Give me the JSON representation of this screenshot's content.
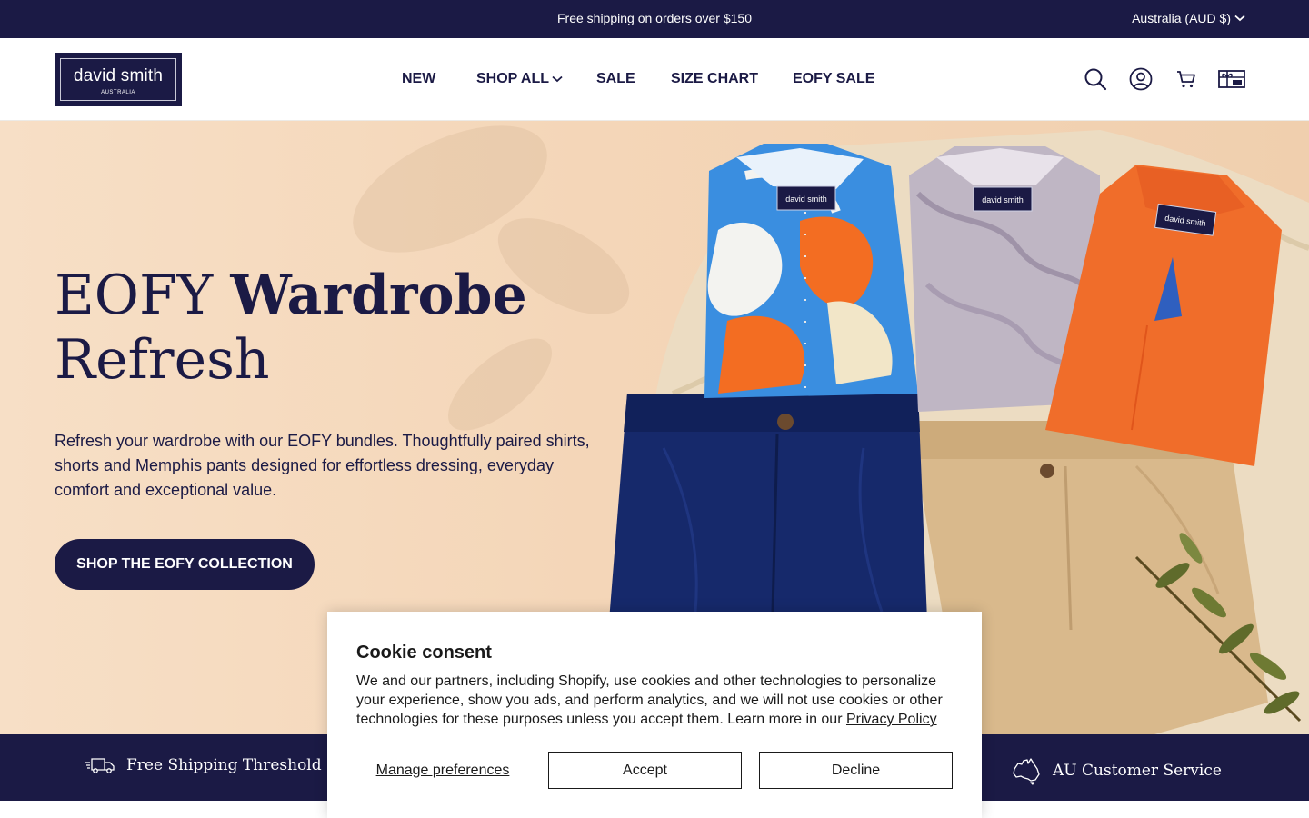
{
  "announcement": {
    "message": "Free shipping on orders over $150",
    "country": "Australia (AUD $)"
  },
  "logo": {
    "name": "david smith",
    "sub": "AUSTRALIA"
  },
  "nav": {
    "new": "NEW",
    "shop_all": "SHOP ALL",
    "sale": "SALE",
    "size_chart": "SIZE CHART",
    "eofy_sale": "EOFY SALE"
  },
  "header_icons": [
    "search-icon",
    "account-icon",
    "cart-icon",
    "gift-card-icon"
  ],
  "hero": {
    "title_part1": "EOFY ",
    "title_part2": "Wardrobe",
    "title_part3": "Refresh",
    "description": "Refresh your wardrobe with our EOFY bundles. Thoughtfully paired shirts, shorts and Memphis pants designed for effortless dressing, everyday comfort and exceptional value.",
    "cta": "SHOP THE EOFY COLLECTION",
    "shirt_label": "david smith"
  },
  "features": {
    "left": "Free Shipping Threshold",
    "right": "AU Customer Service"
  },
  "cookie": {
    "title": "Cookie consent",
    "body": "We and our partners, including Shopify, use cookies and other technologies to personalize your experience, show you ads, and perform analytics, and we will not use cookies or other technologies for these purposes unless you accept them. Learn more in our ",
    "privacy_link": "Privacy Policy",
    "manage": "Manage preferences",
    "accept": "Accept",
    "decline": "Decline"
  },
  "colors": {
    "brand_navy": "#1b1a45",
    "hero_bg": "#f4d6b8",
    "shirt_orange": "#f06d2a",
    "shorts_navy": "#16296b",
    "shorts_khaki": "#d9b98c"
  }
}
